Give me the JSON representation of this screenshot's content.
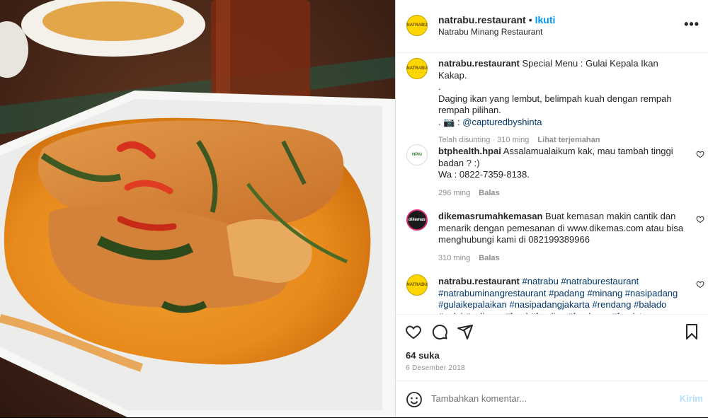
{
  "post_image": {
    "alt": ""
  },
  "header": {
    "username": "natrabu.restaurant",
    "dot": "•",
    "follow": "Ikuti",
    "subtitle": "Natrabu Minang Restaurant",
    "more": "•••",
    "avatar_text": "NATRABU"
  },
  "caption": {
    "username": "natrabu.restaurant",
    "line1": "Special Menu : Gulai Kepala Ikan Kakap.",
    "line2": ".",
    "line3": "Daging ikan yang lembut, belimpah kuah dengan rempah rempah pilihan.",
    "line4_prefix": ". 📷 : ",
    "line4_mention": "@capturedbyshinta",
    "edited": "Telah disunting · 310 ming",
    "translate": "Lihat terjemahan"
  },
  "comments": [
    {
      "username": "btphealth.hpai",
      "text": "Assalamualaikum kak, mau tambah tinggi badan ? :)",
      "text2": "Wa : 0822-7359-8138.",
      "time": "296 ming",
      "reply": "Balas",
      "avatar_text": "HPAI"
    },
    {
      "username": "dikemasrumahkemasan",
      "text": "Buat kemasan makin cantik dan menarik dengan pemesanan di www.dikemas.com atau bisa menghubungi kami di 082199389966",
      "time": "310 ming",
      "reply": "Balas",
      "avatar_text": "dikemas"
    },
    {
      "username": "natrabu.restaurant",
      "tags": "#natrabu #natraburestaurant #natrabuminangrestaurant #padang #minang #nasipadang #gulaikepalaikan #nasipadangjakarta #rendang #balado #gulai #culinary #food #foodies #foodporn #foodstagram",
      "avatar_text": "NATRABU"
    }
  ],
  "actions": {
    "likes": "64 suka",
    "date": "6 Desember 2018"
  },
  "add_comment": {
    "placeholder": "Tambahkan komentar...",
    "post": "Kirim"
  }
}
